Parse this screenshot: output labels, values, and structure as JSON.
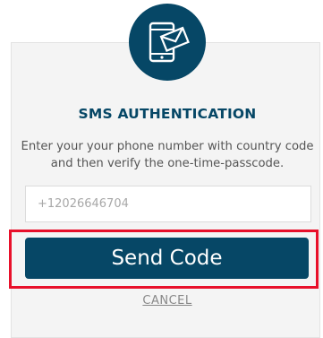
{
  "header": {
    "icon": "phone-message-icon"
  },
  "auth": {
    "title": "SMS AUTHENTICATION",
    "description": "Enter your your phone number with country code and then verify the one-time-passcode.",
    "phone_placeholder": "+12026646704",
    "send_button_label": "Send Code",
    "cancel_label": "CANCEL"
  },
  "colors": {
    "brand": "#064766",
    "highlight": "#e8102a",
    "card_background": "#f4f4f4"
  }
}
